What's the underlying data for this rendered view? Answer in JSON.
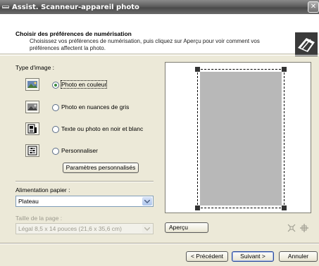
{
  "window": {
    "title": "Assist. Scanneur-appareil photo",
    "close_glyph": "✕"
  },
  "header": {
    "title": "Choisir des préférences de numérisation",
    "description": "Choisissez vos préférences de numérisation, puis cliquez sur Aperçu pour voir comment vos préférences affectent la photo."
  },
  "image_type": {
    "label": "Type d'image :",
    "options": [
      {
        "label": "Photo en couleur",
        "icon": "color-photo-icon",
        "selected": true
      },
      {
        "label": "Photo en nuances de gris",
        "icon": "grayscale-photo-icon",
        "selected": false
      },
      {
        "label": "Texte ou photo en noir et blanc",
        "icon": "black-white-text-icon",
        "selected": false
      },
      {
        "label": "Personnaliser",
        "icon": "custom-settings-icon",
        "selected": false
      }
    ],
    "custom_settings_button": "Paramètres personnalisés"
  },
  "paper_feed": {
    "label": "Alimentation papier :",
    "value": "Plateau"
  },
  "page_size": {
    "label": "Taille de la page :",
    "value": "Légal 8,5 x 14 pouces (21,6 x 35,6 cm)",
    "disabled": true
  },
  "preview": {
    "button": "Aperçu",
    "zoom_icon": "zoom-to-fit-icon",
    "crop_icon": "crop-handles-icon"
  },
  "footer": {
    "back": "< Précédent",
    "next": "Suivant >",
    "cancel": "Annuler"
  },
  "colors": {
    "window_bg": "#ece9d8",
    "titlebar": "#5e5e5e",
    "scan_area_fill": "#b8b8b8",
    "radio_dot": "#3a8a3a"
  }
}
